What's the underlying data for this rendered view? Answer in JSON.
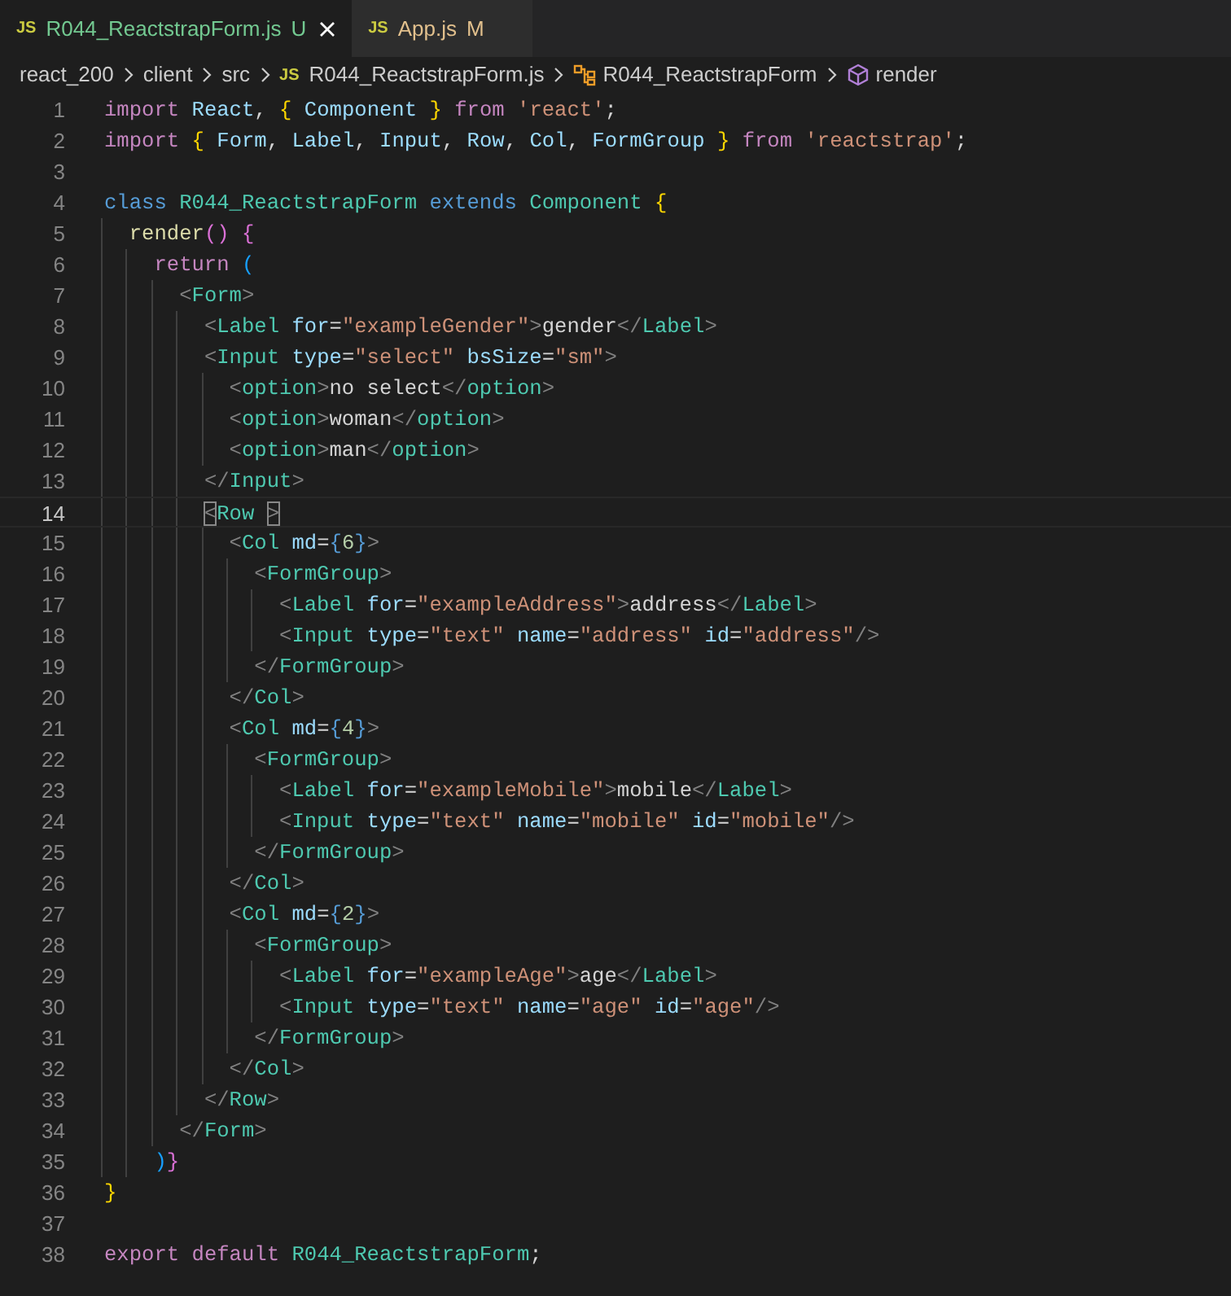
{
  "tabs": [
    {
      "icon_text": "JS",
      "label": "R044_ReactstrapForm.js",
      "status": "U",
      "kind": "untracked",
      "selected": true
    },
    {
      "icon_text": "JS",
      "label": "App.js",
      "status": "M",
      "kind": "modified",
      "selected": false
    }
  ],
  "breadcrumbs": [
    {
      "kind": "folder",
      "label": "react_200"
    },
    {
      "kind": "folder",
      "label": "client"
    },
    {
      "kind": "folder",
      "label": "src"
    },
    {
      "kind": "file",
      "icon_text": "JS",
      "label": "R044_ReactstrapForm.js"
    },
    {
      "kind": "class",
      "label": "R044_ReactstrapForm"
    },
    {
      "kind": "method",
      "label": "render"
    }
  ],
  "lines": [
    {
      "number": "1",
      "tokens": [
        {
          "kind": "kw",
          "text": "import"
        },
        {
          "kind": "var",
          "text": " React"
        },
        {
          "kind": "txt",
          "text": ","
        },
        {
          "kind": "b1",
          "text": " {"
        },
        {
          "kind": "var",
          "text": " Component"
        },
        {
          "kind": "b1",
          "text": " }"
        },
        {
          "kind": "kw",
          "text": " from"
        },
        {
          "kind": "str",
          "text": " 'react'"
        },
        {
          "kind": "txt",
          "text": ";"
        }
      ]
    },
    {
      "number": "2",
      "tokens": [
        {
          "kind": "kw",
          "text": "import"
        },
        {
          "kind": "b1",
          "text": " {"
        },
        {
          "kind": "var",
          "text": " Form"
        },
        {
          "kind": "txt",
          "text": ","
        },
        {
          "kind": "var",
          "text": " Label"
        },
        {
          "kind": "txt",
          "text": ","
        },
        {
          "kind": "var",
          "text": " Input"
        },
        {
          "kind": "txt",
          "text": ","
        },
        {
          "kind": "var",
          "text": " Row"
        },
        {
          "kind": "txt",
          "text": ","
        },
        {
          "kind": "var",
          "text": " Col"
        },
        {
          "kind": "txt",
          "text": ","
        },
        {
          "kind": "var",
          "text": " FormGroup"
        },
        {
          "kind": "b1",
          "text": " }"
        },
        {
          "kind": "kw",
          "text": " from"
        },
        {
          "kind": "str",
          "text": " 'reactstrap'"
        },
        {
          "kind": "txt",
          "text": ";"
        }
      ]
    },
    {
      "number": "3"
    },
    {
      "number": "4",
      "tokens": [
        {
          "kind": "st",
          "text": "class"
        },
        {
          "kind": "cls",
          "text": " R044_ReactstrapForm"
        },
        {
          "kind": "st",
          "text": " extends"
        },
        {
          "kind": "cls",
          "text": " Component"
        },
        {
          "kind": "b1",
          "text": " {"
        }
      ]
    },
    {
      "number": "5",
      "tokens": [
        {
          "kind": "fn",
          "text": "  render"
        },
        {
          "kind": "b2",
          "text": "()"
        },
        {
          "kind": "b2",
          "text": " {"
        }
      ]
    },
    {
      "number": "6",
      "tokens": [
        {
          "kind": "kw",
          "text": "    return"
        },
        {
          "kind": "b3",
          "text": " ("
        }
      ]
    },
    {
      "number": "7",
      "tokens": [
        {
          "kind": "pun",
          "text": "      <"
        },
        {
          "kind": "tag",
          "text": "Form"
        },
        {
          "kind": "pun",
          "text": ">"
        }
      ]
    },
    {
      "number": "8",
      "tokens": [
        {
          "kind": "pun",
          "text": "        <"
        },
        {
          "kind": "tag",
          "text": "Label"
        },
        {
          "kind": "attr",
          "text": " for"
        },
        {
          "kind": "txt",
          "text": "="
        },
        {
          "kind": "str",
          "text": "\"exampleGender\""
        },
        {
          "kind": "pun",
          "text": ">"
        },
        {
          "kind": "txt",
          "text": "gender"
        },
        {
          "kind": "pun",
          "text": "</"
        },
        {
          "kind": "tag",
          "text": "Label"
        },
        {
          "kind": "pun",
          "text": ">"
        }
      ]
    },
    {
      "number": "9",
      "tokens": [
        {
          "kind": "pun",
          "text": "        <"
        },
        {
          "kind": "tag",
          "text": "Input"
        },
        {
          "kind": "attr",
          "text": " type"
        },
        {
          "kind": "txt",
          "text": "="
        },
        {
          "kind": "str",
          "text": "\"select\""
        },
        {
          "kind": "attr",
          "text": " bsSize"
        },
        {
          "kind": "txt",
          "text": "="
        },
        {
          "kind": "str",
          "text": "\"sm\""
        },
        {
          "kind": "pun",
          "text": ">"
        }
      ]
    },
    {
      "number": "10",
      "tokens": [
        {
          "kind": "pun",
          "text": "          <"
        },
        {
          "kind": "tag",
          "text": "option"
        },
        {
          "kind": "pun",
          "text": ">"
        },
        {
          "kind": "txt",
          "text": "no select"
        },
        {
          "kind": "pun",
          "text": "</"
        },
        {
          "kind": "tag",
          "text": "option"
        },
        {
          "kind": "pun",
          "text": ">"
        }
      ]
    },
    {
      "number": "11",
      "tokens": [
        {
          "kind": "pun",
          "text": "          <"
        },
        {
          "kind": "tag",
          "text": "option"
        },
        {
          "kind": "pun",
          "text": ">"
        },
        {
          "kind": "txt",
          "text": "woman"
        },
        {
          "kind": "pun",
          "text": "</"
        },
        {
          "kind": "tag",
          "text": "option"
        },
        {
          "kind": "pun",
          "text": ">"
        }
      ]
    },
    {
      "number": "12",
      "tokens": [
        {
          "kind": "pun",
          "text": "          <"
        },
        {
          "kind": "tag",
          "text": "option"
        },
        {
          "kind": "pun",
          "text": ">"
        },
        {
          "kind": "txt",
          "text": "man"
        },
        {
          "kind": "pun",
          "text": "</"
        },
        {
          "kind": "tag",
          "text": "option"
        },
        {
          "kind": "pun",
          "text": ">"
        }
      ]
    },
    {
      "number": "13",
      "tokens": [
        {
          "kind": "pun",
          "text": "        </"
        },
        {
          "kind": "tag",
          "text": "Input"
        },
        {
          "kind": "pun",
          "text": ">"
        }
      ]
    },
    {
      "number": "14",
      "current": true,
      "tokens": [
        {
          "kind": "pun",
          "text": "        <",
          "matched": true
        },
        {
          "kind": "tag",
          "text": "Row"
        },
        {
          "kind": "pun",
          "text": " >",
          "matched": true
        }
      ]
    },
    {
      "number": "15",
      "tokens": [
        {
          "kind": "pun",
          "text": "          <"
        },
        {
          "kind": "tag",
          "text": "Col"
        },
        {
          "kind": "attr",
          "text": " md"
        },
        {
          "kind": "txt",
          "text": "="
        },
        {
          "kind": "brace",
          "text": "{"
        },
        {
          "kind": "num",
          "text": "6"
        },
        {
          "kind": "brace",
          "text": "}"
        },
        {
          "kind": "pun",
          "text": ">"
        }
      ]
    },
    {
      "number": "16",
      "tokens": [
        {
          "kind": "pun",
          "text": "            <"
        },
        {
          "kind": "tag",
          "text": "FormGroup"
        },
        {
          "kind": "pun",
          "text": ">"
        }
      ]
    },
    {
      "number": "17",
      "tokens": [
        {
          "kind": "pun",
          "text": "              <"
        },
        {
          "kind": "tag",
          "text": "Label"
        },
        {
          "kind": "attr",
          "text": " for"
        },
        {
          "kind": "txt",
          "text": "="
        },
        {
          "kind": "str",
          "text": "\"exampleAddress\""
        },
        {
          "kind": "pun",
          "text": ">"
        },
        {
          "kind": "txt",
          "text": "address"
        },
        {
          "kind": "pun",
          "text": "</"
        },
        {
          "kind": "tag",
          "text": "Label"
        },
        {
          "kind": "pun",
          "text": ">"
        }
      ]
    },
    {
      "number": "18",
      "tokens": [
        {
          "kind": "pun",
          "text": "              <"
        },
        {
          "kind": "tag",
          "text": "Input"
        },
        {
          "kind": "attr",
          "text": " type"
        },
        {
          "kind": "txt",
          "text": "="
        },
        {
          "kind": "str",
          "text": "\"text\""
        },
        {
          "kind": "attr",
          "text": " name"
        },
        {
          "kind": "txt",
          "text": "="
        },
        {
          "kind": "str",
          "text": "\"address\""
        },
        {
          "kind": "attr",
          "text": " id"
        },
        {
          "kind": "txt",
          "text": "="
        },
        {
          "kind": "str",
          "text": "\"address\""
        },
        {
          "kind": "pun",
          "text": "/>"
        }
      ]
    },
    {
      "number": "19",
      "tokens": [
        {
          "kind": "pun",
          "text": "            </"
        },
        {
          "kind": "tag",
          "text": "FormGroup"
        },
        {
          "kind": "pun",
          "text": ">"
        }
      ]
    },
    {
      "number": "20",
      "tokens": [
        {
          "kind": "pun",
          "text": "          </"
        },
        {
          "kind": "tag",
          "text": "Col"
        },
        {
          "kind": "pun",
          "text": ">"
        }
      ]
    },
    {
      "number": "21",
      "tokens": [
        {
          "kind": "pun",
          "text": "          <"
        },
        {
          "kind": "tag",
          "text": "Col"
        },
        {
          "kind": "attr",
          "text": " md"
        },
        {
          "kind": "txt",
          "text": "="
        },
        {
          "kind": "brace",
          "text": "{"
        },
        {
          "kind": "num",
          "text": "4"
        },
        {
          "kind": "brace",
          "text": "}"
        },
        {
          "kind": "pun",
          "text": ">"
        }
      ]
    },
    {
      "number": "22",
      "tokens": [
        {
          "kind": "pun",
          "text": "            <"
        },
        {
          "kind": "tag",
          "text": "FormGroup"
        },
        {
          "kind": "pun",
          "text": ">"
        }
      ]
    },
    {
      "number": "23",
      "tokens": [
        {
          "kind": "pun",
          "text": "              <"
        },
        {
          "kind": "tag",
          "text": "Label"
        },
        {
          "kind": "attr",
          "text": " for"
        },
        {
          "kind": "txt",
          "text": "="
        },
        {
          "kind": "str",
          "text": "\"exampleMobile\""
        },
        {
          "kind": "pun",
          "text": ">"
        },
        {
          "kind": "txt",
          "text": "mobile"
        },
        {
          "kind": "pun",
          "text": "</"
        },
        {
          "kind": "tag",
          "text": "Label"
        },
        {
          "kind": "pun",
          "text": ">"
        }
      ]
    },
    {
      "number": "24",
      "tokens": [
        {
          "kind": "pun",
          "text": "              <"
        },
        {
          "kind": "tag",
          "text": "Input"
        },
        {
          "kind": "attr",
          "text": " type"
        },
        {
          "kind": "txt",
          "text": "="
        },
        {
          "kind": "str",
          "text": "\"text\""
        },
        {
          "kind": "attr",
          "text": " name"
        },
        {
          "kind": "txt",
          "text": "="
        },
        {
          "kind": "str",
          "text": "\"mobile\""
        },
        {
          "kind": "attr",
          "text": " id"
        },
        {
          "kind": "txt",
          "text": "="
        },
        {
          "kind": "str",
          "text": "\"mobile\""
        },
        {
          "kind": "pun",
          "text": "/>"
        }
      ]
    },
    {
      "number": "25",
      "tokens": [
        {
          "kind": "pun",
          "text": "            </"
        },
        {
          "kind": "tag",
          "text": "FormGroup"
        },
        {
          "kind": "pun",
          "text": ">"
        }
      ]
    },
    {
      "number": "26",
      "tokens": [
        {
          "kind": "pun",
          "text": "          </"
        },
        {
          "kind": "tag",
          "text": "Col"
        },
        {
          "kind": "pun",
          "text": ">"
        }
      ]
    },
    {
      "number": "27",
      "tokens": [
        {
          "kind": "pun",
          "text": "          <"
        },
        {
          "kind": "tag",
          "text": "Col"
        },
        {
          "kind": "attr",
          "text": " md"
        },
        {
          "kind": "txt",
          "text": "="
        },
        {
          "kind": "brace",
          "text": "{"
        },
        {
          "kind": "num",
          "text": "2"
        },
        {
          "kind": "brace",
          "text": "}"
        },
        {
          "kind": "pun",
          "text": ">"
        }
      ]
    },
    {
      "number": "28",
      "tokens": [
        {
          "kind": "pun",
          "text": "            <"
        },
        {
          "kind": "tag",
          "text": "FormGroup"
        },
        {
          "kind": "pun",
          "text": ">"
        }
      ]
    },
    {
      "number": "29",
      "tokens": [
        {
          "kind": "pun",
          "text": "              <"
        },
        {
          "kind": "tag",
          "text": "Label"
        },
        {
          "kind": "attr",
          "text": " for"
        },
        {
          "kind": "txt",
          "text": "="
        },
        {
          "kind": "str",
          "text": "\"exampleAge\""
        },
        {
          "kind": "pun",
          "text": ">"
        },
        {
          "kind": "txt",
          "text": "age"
        },
        {
          "kind": "pun",
          "text": "</"
        },
        {
          "kind": "tag",
          "text": "Label"
        },
        {
          "kind": "pun",
          "text": ">"
        }
      ]
    },
    {
      "number": "30",
      "tokens": [
        {
          "kind": "pun",
          "text": "              <"
        },
        {
          "kind": "tag",
          "text": "Input"
        },
        {
          "kind": "attr",
          "text": " type"
        },
        {
          "kind": "txt",
          "text": "="
        },
        {
          "kind": "str",
          "text": "\"text\""
        },
        {
          "kind": "attr",
          "text": " name"
        },
        {
          "kind": "txt",
          "text": "="
        },
        {
          "kind": "str",
          "text": "\"age\""
        },
        {
          "kind": "attr",
          "text": " id"
        },
        {
          "kind": "txt",
          "text": "="
        },
        {
          "kind": "str",
          "text": "\"age\""
        },
        {
          "kind": "pun",
          "text": "/>"
        }
      ]
    },
    {
      "number": "31",
      "tokens": [
        {
          "kind": "pun",
          "text": "            </"
        },
        {
          "kind": "tag",
          "text": "FormGroup"
        },
        {
          "kind": "pun",
          "text": ">"
        }
      ]
    },
    {
      "number": "32",
      "tokens": [
        {
          "kind": "pun",
          "text": "          </"
        },
        {
          "kind": "tag",
          "text": "Col"
        },
        {
          "kind": "pun",
          "text": ">"
        }
      ]
    },
    {
      "number": "33",
      "tokens": [
        {
          "kind": "pun",
          "text": "        </"
        },
        {
          "kind": "tag",
          "text": "Row"
        },
        {
          "kind": "pun",
          "text": ">"
        }
      ]
    },
    {
      "number": "34",
      "tokens": [
        {
          "kind": "pun",
          "text": "      </"
        },
        {
          "kind": "tag",
          "text": "Form"
        },
        {
          "kind": "pun",
          "text": ">"
        }
      ]
    },
    {
      "number": "35",
      "tokens": [
        {
          "kind": "b3",
          "text": "    )"
        },
        {
          "kind": "b2",
          "text": "}"
        }
      ]
    },
    {
      "number": "36",
      "tokens": [
        {
          "kind": "b1",
          "text": "}"
        }
      ]
    },
    {
      "number": "37"
    },
    {
      "number": "38",
      "tokens": [
        {
          "kind": "kw",
          "text": "export"
        },
        {
          "kind": "kw",
          "text": " default"
        },
        {
          "kind": "cls",
          "text": " R044_ReactstrapForm"
        },
        {
          "kind": "txt",
          "text": ";"
        }
      ]
    }
  ]
}
